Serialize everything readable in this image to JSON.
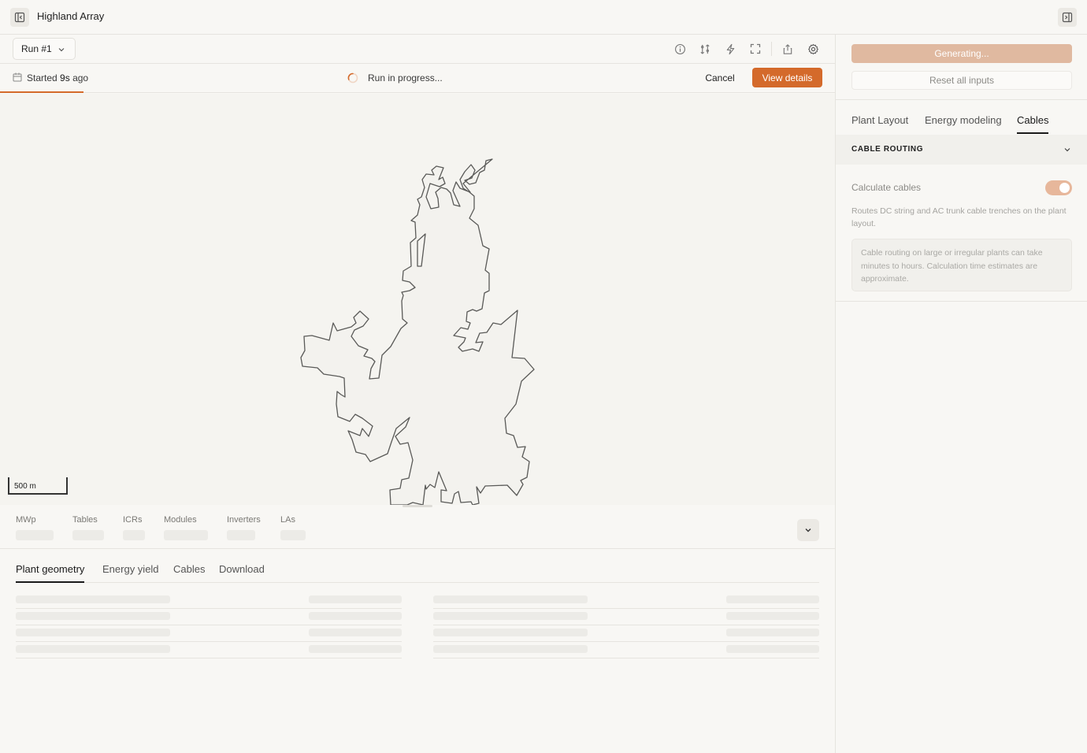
{
  "header": {
    "title": "Highland Array",
    "left_toggle_icon": "sidebar-left-icon",
    "right_toggle_icon": "sidebar-right-icon"
  },
  "toolbar": {
    "run_label": "Run #1",
    "icons": [
      "info-icon",
      "compare-icon",
      "lightning-icon",
      "fullscreen-icon",
      "share-icon",
      "gear-icon"
    ]
  },
  "status": {
    "started_prefix": "Started",
    "started_value": "9s",
    "started_suffix": "ago",
    "progress_text": "Run in progress...",
    "cancel_label": "Cancel",
    "view_details_label": "View details",
    "accent_color": "#d46a2b"
  },
  "map": {
    "scale_label": "500 m"
  },
  "stats": {
    "labels": [
      "MWp",
      "Tables",
      "ICRs",
      "Modules",
      "Inverters",
      "LAs"
    ]
  },
  "bottom_tabs": [
    "Plant geometry",
    "Energy yield",
    "Cables",
    "Download"
  ],
  "bottom_active_tab": "Plant geometry",
  "side": {
    "generating_label": "Generating...",
    "reset_label": "Reset all inputs",
    "tabs": [
      "Plant Layout",
      "Energy modeling",
      "Cables"
    ],
    "active_tab": "Cables",
    "section_title": "CABLE ROUTING",
    "calc_label": "Calculate cables",
    "calc_enabled": true,
    "description": "Routes DC string and AC trunk cable trenches on the plant layout.",
    "note": "Cable routing on large or irregular plants can take minutes to hours. Calculation time estimates are approximate."
  }
}
